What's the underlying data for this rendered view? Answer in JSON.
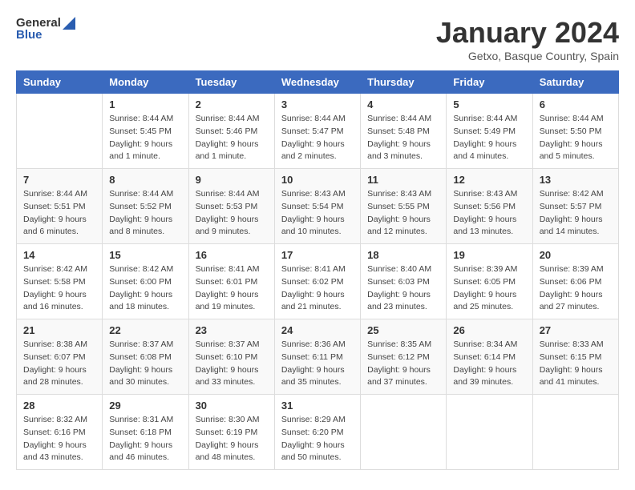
{
  "header": {
    "logo_general": "General",
    "logo_blue": "Blue",
    "month_title": "January 2024",
    "subtitle": "Getxo, Basque Country, Spain"
  },
  "days_of_week": [
    "Sunday",
    "Monday",
    "Tuesday",
    "Wednesday",
    "Thursday",
    "Friday",
    "Saturday"
  ],
  "weeks": [
    [
      {
        "num": "",
        "info": ""
      },
      {
        "num": "1",
        "info": "Sunrise: 8:44 AM\nSunset: 5:45 PM\nDaylight: 9 hours\nand 1 minute."
      },
      {
        "num": "2",
        "info": "Sunrise: 8:44 AM\nSunset: 5:46 PM\nDaylight: 9 hours\nand 1 minute."
      },
      {
        "num": "3",
        "info": "Sunrise: 8:44 AM\nSunset: 5:47 PM\nDaylight: 9 hours\nand 2 minutes."
      },
      {
        "num": "4",
        "info": "Sunrise: 8:44 AM\nSunset: 5:48 PM\nDaylight: 9 hours\nand 3 minutes."
      },
      {
        "num": "5",
        "info": "Sunrise: 8:44 AM\nSunset: 5:49 PM\nDaylight: 9 hours\nand 4 minutes."
      },
      {
        "num": "6",
        "info": "Sunrise: 8:44 AM\nSunset: 5:50 PM\nDaylight: 9 hours\nand 5 minutes."
      }
    ],
    [
      {
        "num": "7",
        "info": "Sunrise: 8:44 AM\nSunset: 5:51 PM\nDaylight: 9 hours\nand 6 minutes."
      },
      {
        "num": "8",
        "info": "Sunrise: 8:44 AM\nSunset: 5:52 PM\nDaylight: 9 hours\nand 8 minutes."
      },
      {
        "num": "9",
        "info": "Sunrise: 8:44 AM\nSunset: 5:53 PM\nDaylight: 9 hours\nand 9 minutes."
      },
      {
        "num": "10",
        "info": "Sunrise: 8:43 AM\nSunset: 5:54 PM\nDaylight: 9 hours\nand 10 minutes."
      },
      {
        "num": "11",
        "info": "Sunrise: 8:43 AM\nSunset: 5:55 PM\nDaylight: 9 hours\nand 12 minutes."
      },
      {
        "num": "12",
        "info": "Sunrise: 8:43 AM\nSunset: 5:56 PM\nDaylight: 9 hours\nand 13 minutes."
      },
      {
        "num": "13",
        "info": "Sunrise: 8:42 AM\nSunset: 5:57 PM\nDaylight: 9 hours\nand 14 minutes."
      }
    ],
    [
      {
        "num": "14",
        "info": "Sunrise: 8:42 AM\nSunset: 5:58 PM\nDaylight: 9 hours\nand 16 minutes."
      },
      {
        "num": "15",
        "info": "Sunrise: 8:42 AM\nSunset: 6:00 PM\nDaylight: 9 hours\nand 18 minutes."
      },
      {
        "num": "16",
        "info": "Sunrise: 8:41 AM\nSunset: 6:01 PM\nDaylight: 9 hours\nand 19 minutes."
      },
      {
        "num": "17",
        "info": "Sunrise: 8:41 AM\nSunset: 6:02 PM\nDaylight: 9 hours\nand 21 minutes."
      },
      {
        "num": "18",
        "info": "Sunrise: 8:40 AM\nSunset: 6:03 PM\nDaylight: 9 hours\nand 23 minutes."
      },
      {
        "num": "19",
        "info": "Sunrise: 8:39 AM\nSunset: 6:05 PM\nDaylight: 9 hours\nand 25 minutes."
      },
      {
        "num": "20",
        "info": "Sunrise: 8:39 AM\nSunset: 6:06 PM\nDaylight: 9 hours\nand 27 minutes."
      }
    ],
    [
      {
        "num": "21",
        "info": "Sunrise: 8:38 AM\nSunset: 6:07 PM\nDaylight: 9 hours\nand 28 minutes."
      },
      {
        "num": "22",
        "info": "Sunrise: 8:37 AM\nSunset: 6:08 PM\nDaylight: 9 hours\nand 30 minutes."
      },
      {
        "num": "23",
        "info": "Sunrise: 8:37 AM\nSunset: 6:10 PM\nDaylight: 9 hours\nand 33 minutes."
      },
      {
        "num": "24",
        "info": "Sunrise: 8:36 AM\nSunset: 6:11 PM\nDaylight: 9 hours\nand 35 minutes."
      },
      {
        "num": "25",
        "info": "Sunrise: 8:35 AM\nSunset: 6:12 PM\nDaylight: 9 hours\nand 37 minutes."
      },
      {
        "num": "26",
        "info": "Sunrise: 8:34 AM\nSunset: 6:14 PM\nDaylight: 9 hours\nand 39 minutes."
      },
      {
        "num": "27",
        "info": "Sunrise: 8:33 AM\nSunset: 6:15 PM\nDaylight: 9 hours\nand 41 minutes."
      }
    ],
    [
      {
        "num": "28",
        "info": "Sunrise: 8:32 AM\nSunset: 6:16 PM\nDaylight: 9 hours\nand 43 minutes."
      },
      {
        "num": "29",
        "info": "Sunrise: 8:31 AM\nSunset: 6:18 PM\nDaylight: 9 hours\nand 46 minutes."
      },
      {
        "num": "30",
        "info": "Sunrise: 8:30 AM\nSunset: 6:19 PM\nDaylight: 9 hours\nand 48 minutes."
      },
      {
        "num": "31",
        "info": "Sunrise: 8:29 AM\nSunset: 6:20 PM\nDaylight: 9 hours\nand 50 minutes."
      },
      {
        "num": "",
        "info": ""
      },
      {
        "num": "",
        "info": ""
      },
      {
        "num": "",
        "info": ""
      }
    ]
  ]
}
